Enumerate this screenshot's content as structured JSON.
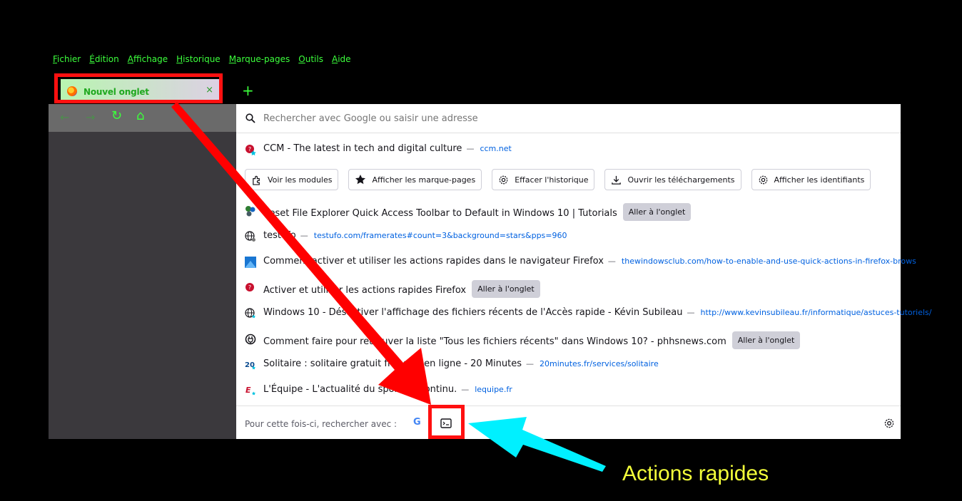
{
  "menu": [
    "Fichier",
    "Édition",
    "Affichage",
    "Historique",
    "Marque-pages",
    "Outils",
    "Aide"
  ],
  "tab": {
    "title": "Nouvel onglet",
    "close": "×",
    "new_tab": "+"
  },
  "nav": {
    "back": "←",
    "forward": "→",
    "reload": "↻",
    "home": "⌂"
  },
  "search": {
    "placeholder": "Rechercher avec Google ou saisir une adresse"
  },
  "top_result": {
    "title": "CCM - The latest in tech and digital culture",
    "url": "ccm.net"
  },
  "quick_actions": [
    {
      "label": "Voir les modules",
      "icon": "puzzle-icon"
    },
    {
      "label": "Afficher les marque-pages",
      "icon": "star-icon"
    },
    {
      "label": "Effacer l'historique",
      "icon": "gear-icon"
    },
    {
      "label": "Ouvrir les téléchargements",
      "icon": "download-icon"
    },
    {
      "label": "Afficher les identifiants",
      "icon": "gear-icon"
    }
  ],
  "results": [
    {
      "title": "Reset File Explorer Quick Access Toolbar to Default in Windows 10 | Tutorials",
      "url": "",
      "switch": "Aller à l'onglet"
    },
    {
      "title": "testufo",
      "url": "testufo.com/framerates#count=3&background=stars&pps=960",
      "switch": ""
    },
    {
      "title": "Comment activer et utiliser les actions rapides dans le navigateur Firefox",
      "url": "thewindowsclub.com/how-to-enable-and-use-quick-actions-in-firefox-brows",
      "switch": ""
    },
    {
      "title": "Activer et utiliser les actions rapides Firefox",
      "url": "",
      "switch": "Aller à l'onglet"
    },
    {
      "title": "Windows 10 - Désactiver l'affichage des fichiers récents de l'Accès rapide - Kévin Subileau",
      "url": "http://www.kevinsubileau.fr/informatique/astuces-tutoriels/",
      "switch": ""
    },
    {
      "title": "Comment faire pour retrouver la liste \"Tous les fichiers récents\" dans Windows 10? - phhsnews.com",
      "url": "",
      "switch": "Aller à l'onglet"
    },
    {
      "title": "Solitaire : solitaire gratuit français en ligne - 20 Minutes",
      "url": "20minutes.fr/services/solitaire",
      "switch": ""
    },
    {
      "title": "L'Équipe - L'actualité du sport en continu.",
      "url": "lequipe.fr",
      "switch": ""
    }
  ],
  "footer": {
    "label": "Pour cette fois-ci, rechercher avec :",
    "google": "G"
  },
  "annotation": "Actions rapides",
  "colors": {
    "menu_text": "#3cff3c",
    "highlight_frame": "#ff1010",
    "arrow_red": "#ff0000",
    "arrow_cyan": "#00f0ff",
    "caption": "#f4ff3a"
  }
}
